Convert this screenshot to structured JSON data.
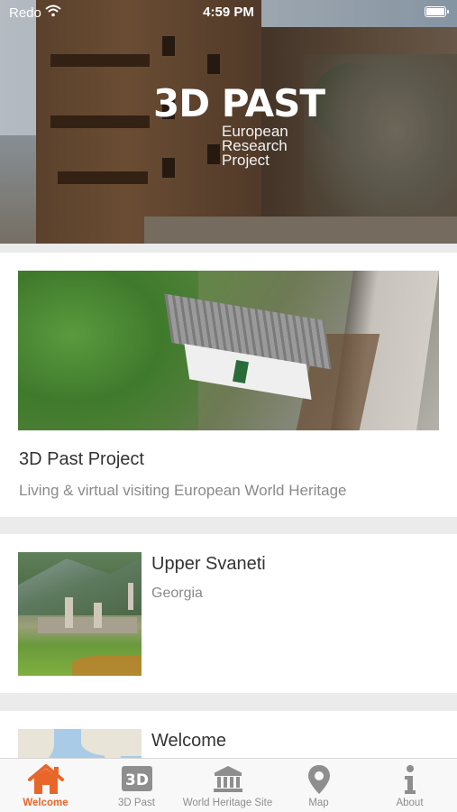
{
  "status_bar": {
    "carrier": "Redo",
    "time": "4:59 PM",
    "battery_level": 1.0
  },
  "hero": {
    "logo_main": "3D PAST",
    "logo_lines": [
      "European",
      "Research",
      "Project"
    ]
  },
  "cards": [
    {
      "title": "3D Past Project",
      "subtitle": "Living & virtual visiting European World Heritage"
    }
  ],
  "list": [
    {
      "title": "Upper Svaneti",
      "subtitle": "Georgia"
    },
    {
      "title": "Welcome"
    }
  ],
  "tabbar": {
    "active_color": "#E8662A",
    "inactive_color": "#8E8E8E",
    "tabs": [
      {
        "label": "Welcome",
        "icon": "home-icon",
        "active": true
      },
      {
        "label": "3D Past",
        "icon": "3d-icon",
        "active": false
      },
      {
        "label": "World Heritage Site",
        "icon": "temple-icon",
        "active": false
      },
      {
        "label": "Map",
        "icon": "map-pin-icon",
        "active": false
      },
      {
        "label": "About",
        "icon": "info-icon",
        "active": false
      }
    ]
  }
}
